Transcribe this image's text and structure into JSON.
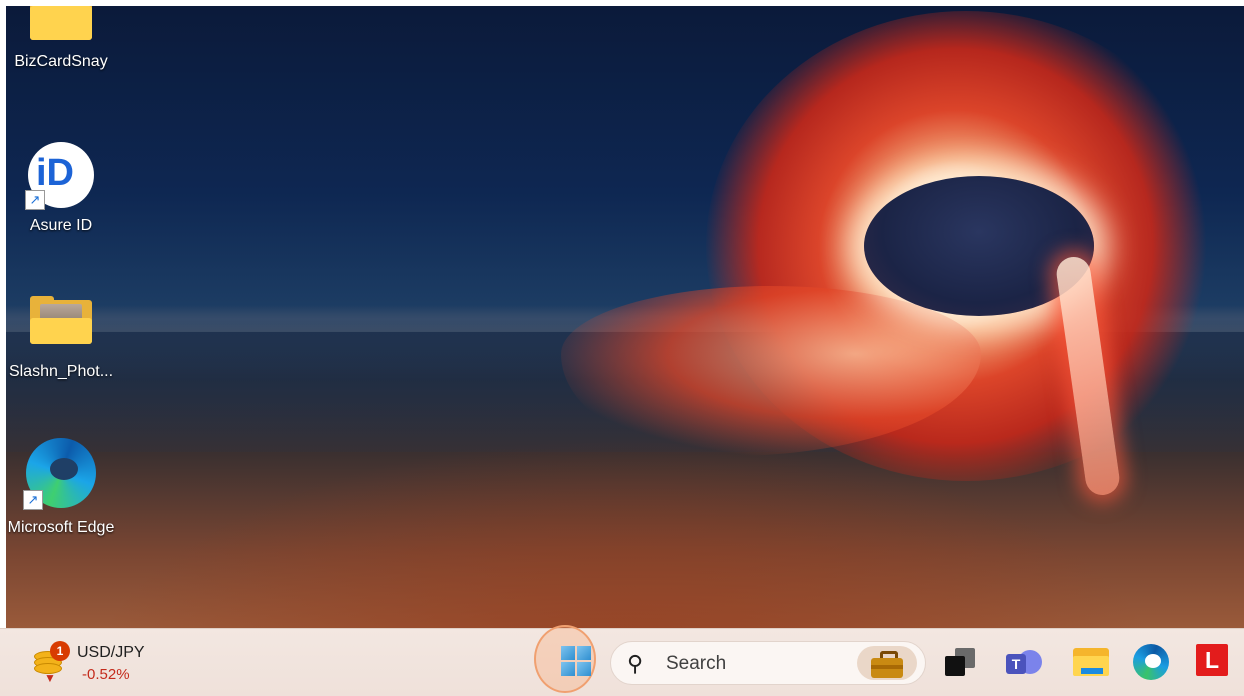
{
  "desktop": {
    "icons": [
      {
        "label": "BizCardSnay",
        "icon": "folder-icon"
      },
      {
        "label": "Asure ID",
        "icon": "asure-id-icon"
      },
      {
        "label": "Slashn_Phot...",
        "icon": "folder-icon"
      },
      {
        "label": "Microsoft Edge",
        "icon": "edge-icon"
      }
    ],
    "asure_mark": "iD"
  },
  "taskbar": {
    "widget": {
      "title": "USD/JPY",
      "value": "-0.52%",
      "badge": "1"
    },
    "search": {
      "placeholder": "Search"
    },
    "icons": [
      "start-icon",
      "search-icon",
      "briefcase-icon",
      "task-view-icon",
      "teams-icon",
      "file-explorer-icon",
      "edge-icon",
      "l-app-icon"
    ],
    "l_app_label": "L"
  },
  "colors": {
    "accent_red": "#c42b1c",
    "taskbar_bg": "#f0e2dc",
    "start_highlight": "#f0a070"
  }
}
